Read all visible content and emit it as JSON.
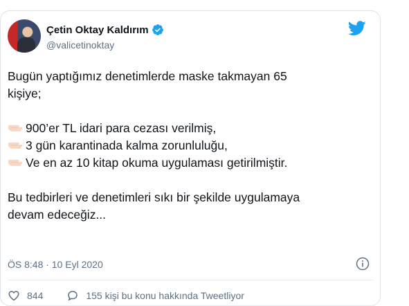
{
  "author": {
    "name": "Çetin Oktay Kaldırım",
    "handle": "@valicetinoktay",
    "verified": true
  },
  "tweet": {
    "line1": "Bugün yaptığımız denetimlerde maske takmayan 65",
    "line2": "kişiye;",
    "bullets": [
      "900’er TL idari para cezası verilmiş,",
      "3 gün karantinada kalma zorunluluğu,",
      "Ve en az 10 kitap okuma uygulaması getirilmiştir."
    ],
    "line3": "Bu tedbirleri ve denetimleri sıkı bir şekilde uygulamaya",
    "line4": "devam edeceğiz..."
  },
  "meta": {
    "timestamp": "ÖS 8:48 · 10 Eyl 2020"
  },
  "actions": {
    "likes": "844",
    "reply_text": "155 kişi bu konu hakkında Tweetliyor"
  },
  "colors": {
    "accent": "#1da1f2",
    "secondary_text": "#5b7083",
    "emoji_hand": "#f7d7c4"
  },
  "icons": [
    "verified-badge-icon",
    "twitter-bird-icon",
    "pointing-hand-icon",
    "info-icon",
    "heart-icon",
    "speech-bubble-icon"
  ]
}
